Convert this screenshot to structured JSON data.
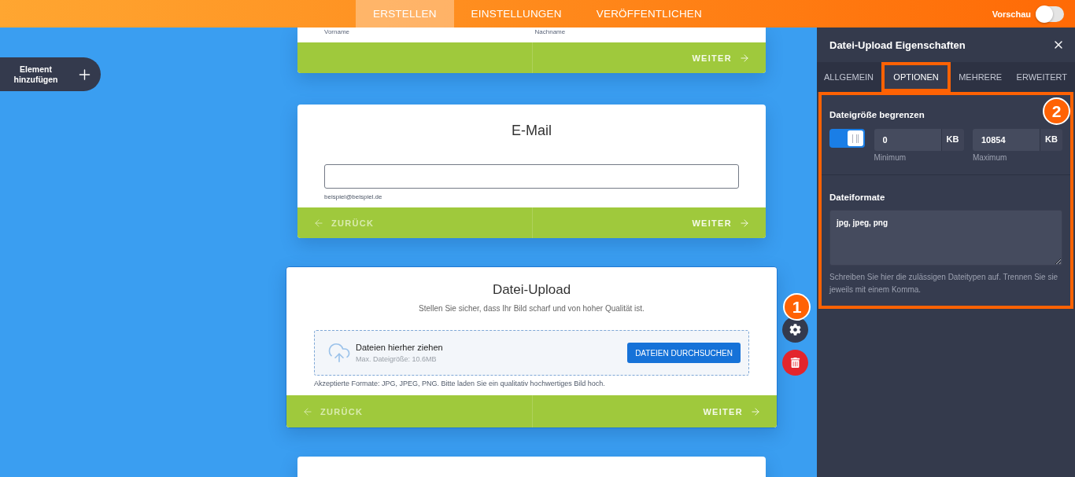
{
  "top_bar": {
    "tabs": [
      {
        "label": "ERSTELLEN",
        "selected": true
      },
      {
        "label": "EINSTELLUNGEN",
        "selected": false
      },
      {
        "label": "VERÖFFENTLICHEN",
        "selected": false
      }
    ],
    "preview": {
      "label": "Vorschau",
      "on": false
    }
  },
  "add_element_button": {
    "label": "Element hinzufügen"
  },
  "form_cards": [
    {
      "kind": "fields",
      "selected": false,
      "sublabels": [
        "Vorname",
        "Nachname"
      ],
      "next": "WEITER"
    },
    {
      "kind": "email",
      "selected": false,
      "title": "E-Mail",
      "hint": "beispiel@beispiel.de",
      "back": "ZURÜCK",
      "next": "WEITER"
    },
    {
      "kind": "upload",
      "selected": true,
      "title": "Datei-Upload",
      "subtitle": "Stellen Sie sicher, dass Ihr Bild scharf und von hoher Qualität ist.",
      "dropzone": {
        "title": "Dateien hierher ziehen",
        "size_note": "Max. Dateigröße: 10.6MB",
        "button": "DATEIEN DURCHSUCHEN"
      },
      "note": "Akzeptierte Formate: JPG, JPEG, PNG. Bitte laden Sie ein qualitativ hochwertiges Bild hoch.",
      "back": "ZURÜCK",
      "next": "WEITER",
      "step_badge": "1"
    },
    {
      "kind": "blank",
      "selected": false
    }
  ],
  "properties_panel": {
    "title": "Datei-Upload Eigenschaften",
    "tabs": [
      {
        "label": "ALLGEMEIN",
        "selected": false,
        "highlighted": false
      },
      {
        "label": "OPTIONEN",
        "selected": true,
        "highlighted": true
      },
      {
        "label": "MEHRERE",
        "selected": false,
        "highlighted": false
      },
      {
        "label": "ERWEITERT",
        "selected": false,
        "highlighted": false
      }
    ],
    "highlighted": true,
    "step_badge": "2",
    "size_limit": {
      "heading": "Dateigröße begrenzen",
      "on": true,
      "fields": [
        {
          "value": "0",
          "unit": "KB",
          "label": "Minimum"
        },
        {
          "value": "10854",
          "unit": "KB",
          "label": "Maximum"
        }
      ]
    },
    "file_formats": {
      "heading": "Dateiformate",
      "value": "jpg, jpeg, png",
      "help": "Schreiben Sie hier die zulässigen Dateitypen auf. Trennen Sie sie jeweils mit einem Komma."
    }
  }
}
